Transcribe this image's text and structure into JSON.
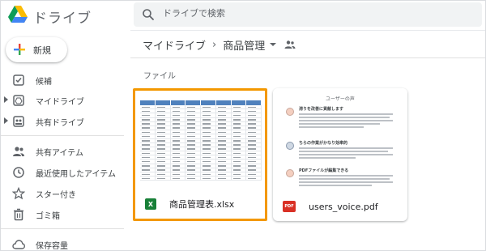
{
  "app": {
    "title": "ドライブ",
    "logo_icon": "google-drive-logo"
  },
  "search": {
    "placeholder": "ドライブで検索",
    "value": ""
  },
  "sidebar": {
    "new_button": {
      "label": "新規",
      "icon": "colored-plus-icon"
    },
    "items": [
      {
        "label": "候補",
        "icon": "check-square-icon",
        "expandable": false
      },
      {
        "label": "マイドライブ",
        "icon": "my-drive-icon",
        "expandable": true
      },
      {
        "label": "共有ドライブ",
        "icon": "shared-drive-icon",
        "expandable": true
      },
      {
        "label": "共有アイテム",
        "icon": "people-icon",
        "expandable": false
      },
      {
        "label": "最近使用したアイテム",
        "icon": "clock-icon",
        "expandable": false
      },
      {
        "label": "スター付き",
        "icon": "star-icon",
        "expandable": false
      },
      {
        "label": "ゴミ箱",
        "icon": "trash-icon",
        "expandable": false
      },
      {
        "label": "保存容量",
        "icon": "cloud-icon",
        "expandable": false
      }
    ]
  },
  "breadcrumb": {
    "root": "マイドライブ",
    "separator": "›",
    "current": "商品管理"
  },
  "files_section": {
    "label": "ファイル"
  },
  "files": [
    {
      "name": "商品管理表.xlsx",
      "type": "xlsx",
      "icon_label": "X",
      "icon_color": "#188038",
      "selected": true
    },
    {
      "name": "users_voice.pdf",
      "type": "pdf",
      "icon_label": "PDF",
      "icon_color": "#d93025",
      "selected": false
    }
  ],
  "pdf_preview": {
    "title": "ユーザーの声",
    "entries": [
      {
        "heading": "滞りを改善に貢献します"
      },
      {
        "heading": "ちらの作業がかなり効率的"
      },
      {
        "heading": "PDFファイルが編集できる"
      }
    ]
  },
  "colors": {
    "selection_border": "#f39800",
    "accent_blue": "#1a73e8",
    "sheet_header": "#4f81bd"
  }
}
